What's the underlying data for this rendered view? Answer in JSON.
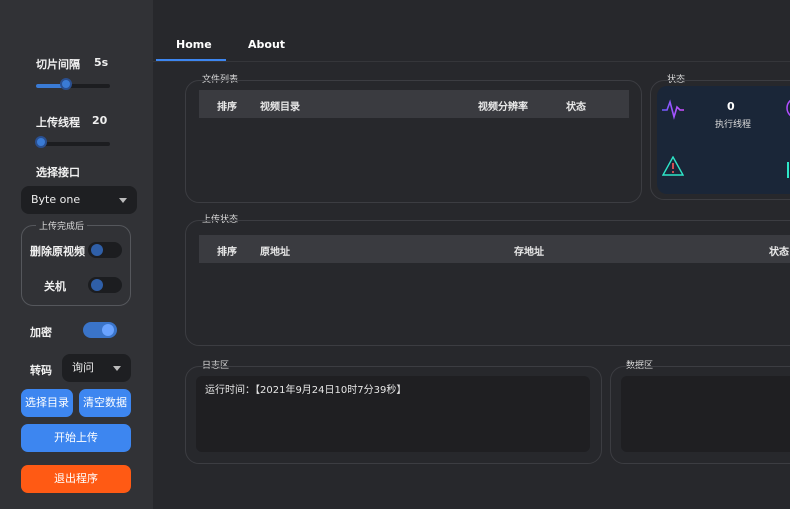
{
  "sidebar": {
    "slice_interval": {
      "label": "切片间隔",
      "value": "5s",
      "level": 0.45
    },
    "upload_threads": {
      "label": "上传线程",
      "value": "20",
      "level": 0.05
    },
    "interface": {
      "label": "选择接口",
      "selected": "Byte one"
    },
    "after_upload": {
      "title": "上传完成后",
      "delete_source": {
        "label": "删除原视频",
        "on": false
      },
      "shutdown": {
        "label": "关机",
        "on": false
      }
    },
    "encrypt": {
      "label": "加密",
      "on": true
    },
    "transcode": {
      "label": "转码",
      "selected": "询问"
    },
    "buttons": {
      "select_dir": "选择目录",
      "clear_data": "清空数据",
      "start_upload": "开始上传",
      "exit": "退出程序"
    }
  },
  "tabs": [
    {
      "label": "Home",
      "active": true
    },
    {
      "label": "About",
      "active": false
    }
  ],
  "file_list": {
    "title": "文件列表",
    "columns": [
      "排序",
      "视频目录",
      "视频分辨率",
      "状态"
    ]
  },
  "status": {
    "title": "状态",
    "threads_value": "0",
    "threads_label": "执行线程"
  },
  "upload_status": {
    "title": "上传状态",
    "columns": [
      "排序",
      "原地址",
      "存地址",
      "状态"
    ]
  },
  "log": {
    "title": "日志区",
    "lines": [
      "运行时间：【2021年9月24日10时7分39秒】"
    ]
  },
  "data_area": {
    "title": "数据区"
  },
  "colors": {
    "accent": "#3d86f0",
    "danger": "#ff5a14",
    "background": "#27282c",
    "sidebar": "#313236"
  }
}
